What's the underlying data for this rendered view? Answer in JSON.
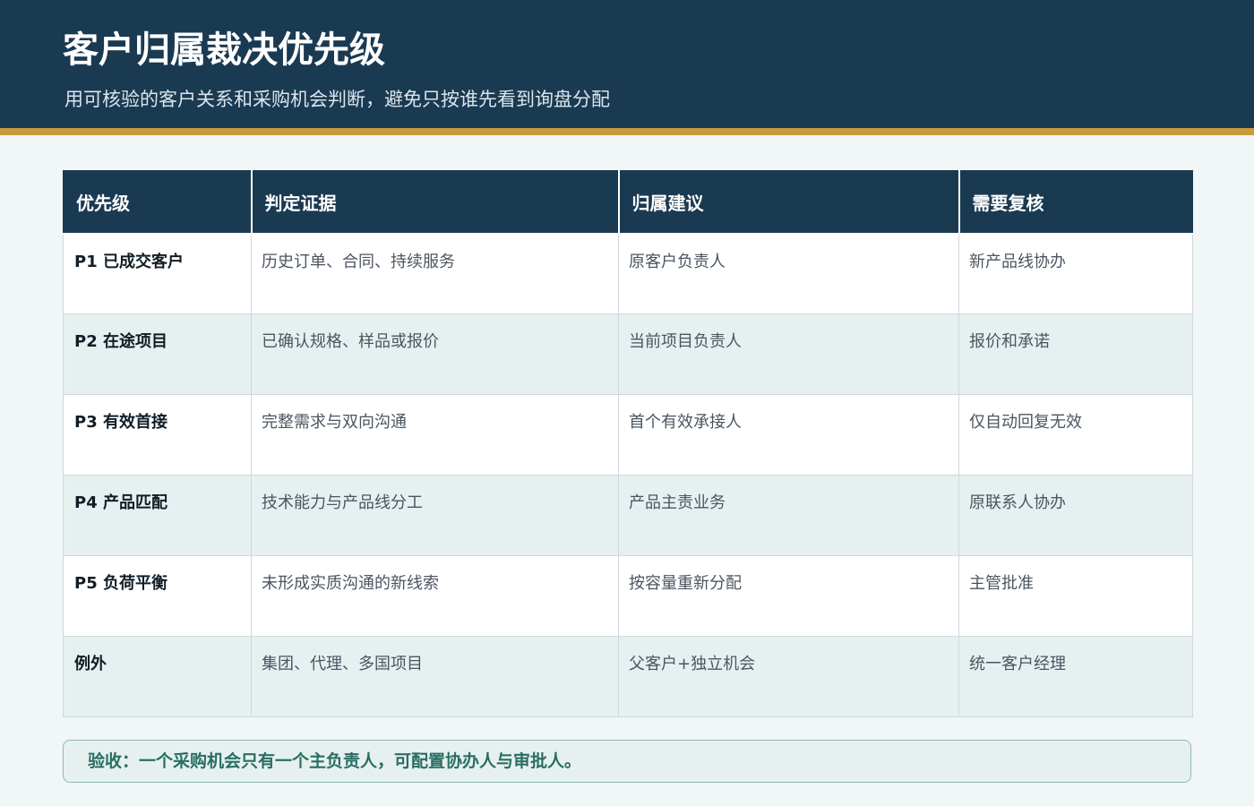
{
  "header": {
    "title": "客户归属裁决优先级",
    "subtitle": "用可核验的客户关系和采购机会判断，避免只按谁先看到询盘分配"
  },
  "table": {
    "columns": [
      "优先级",
      "判定证据",
      "归属建议",
      "需要复核"
    ],
    "rows": [
      {
        "priority": "P1 已成交客户",
        "evidence": "历史订单、合同、持续服务",
        "assignment": "原客户负责人",
        "review": "新产品线协办"
      },
      {
        "priority": "P2 在途项目",
        "evidence": "已确认规格、样品或报价",
        "assignment": "当前项目负责人",
        "review": "报价和承诺"
      },
      {
        "priority": "P3 有效首接",
        "evidence": "完整需求与双向沟通",
        "assignment": "首个有效承接人",
        "review": "仅自动回复无效"
      },
      {
        "priority": "P4 产品匹配",
        "evidence": "技术能力与产品线分工",
        "assignment": "产品主责业务",
        "review": "原联系人协办"
      },
      {
        "priority": "P5 负荷平衡",
        "evidence": "未形成实质沟通的新线索",
        "assignment": "按容量重新分配",
        "review": "主管批准"
      },
      {
        "priority": "例外",
        "evidence": "集团、代理、多国项目",
        "assignment": "父客户+独立机会",
        "review": "统一客户经理"
      }
    ]
  },
  "footer": {
    "note": "验收：一个采购机会只有一个主负责人，可配置协办人与审批人。"
  }
}
